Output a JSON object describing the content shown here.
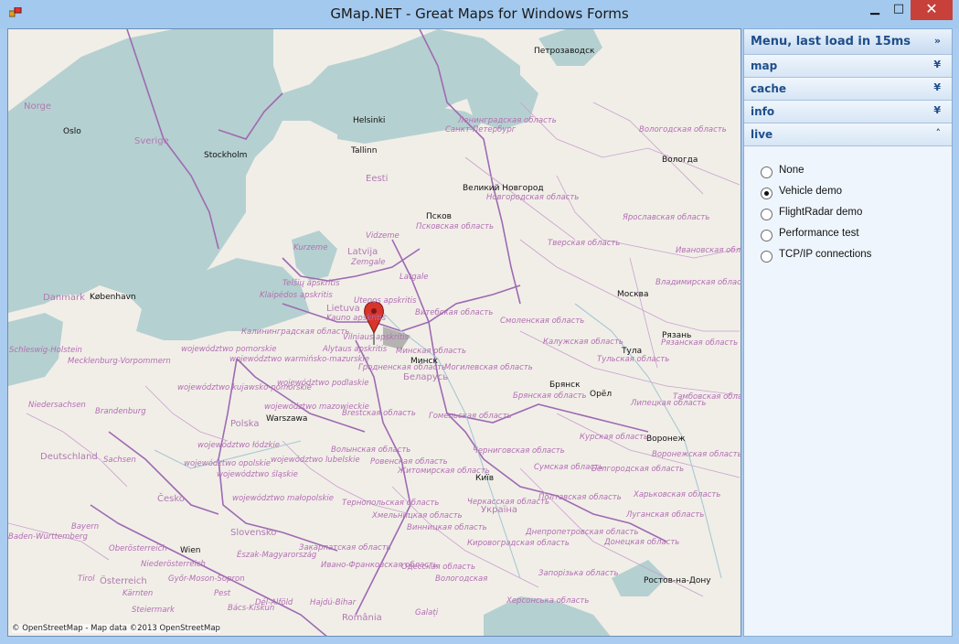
{
  "window": {
    "title": "GMap.NET - Great Maps for Windows Forms",
    "minimize": "▁",
    "maximize": "□",
    "close": "✕"
  },
  "map": {
    "copyright": "© OpenStreetMap - Map data ©2013 OpenStreetMap",
    "cities": [
      "Петрозаводск",
      "Helsinki",
      "Stockholm",
      "Oslo",
      "Tallinn",
      "Вологда",
      "Великий Новгород",
      "Псков",
      "København",
      "Москва",
      "Рязань",
      "Тула",
      "Минск",
      "Брянск",
      "Орёл",
      "Warszawa",
      "Воронеж",
      "Київ",
      "Wien",
      "Ростов-на-Дону"
    ],
    "countries": [
      "Norge",
      "Sverige",
      "Eesti",
      "Latvija",
      "Lietuva",
      "Danmark",
      "Беларусь",
      "Polska",
      "Deutschland",
      "Česko",
      "Slovensko",
      "Україна",
      "România",
      "Österreich"
    ],
    "regions": [
      "Ленинградская область",
      "Санкт-Петербург",
      "Вологодская область",
      "Новгородская область",
      "Псковская область",
      "Ярославская область",
      "Тверская область",
      "Ивановская область",
      "Kurzeme",
      "Vidzeme",
      "Zemgale",
      "Latgale",
      "Telšių apskritis",
      "Klaipėdos apskritis",
      "Kauno apskritis",
      "Utenos apskritis",
      "Витебская область",
      "Смоленская область",
      "Владимирская область",
      "Калининградская область",
      "Vilniaus apskritis",
      "Alytaus apskritis",
      "Минская область",
      "Калужская область",
      "Рязанская область",
      "Тульская область",
      "Гродненская область",
      "Могилевская область",
      "Брянская область",
      "Липецкая область",
      "Тамбовская область",
      "Brestская область",
      "Гомельская область",
      "Курская область",
      "Воронежская область",
      "Черниговская область",
      "Сумская область",
      "Белгородская область",
      "Волынская область",
      "Ровенская область",
      "Житомирская область",
      "Полтавская область",
      "Харьковская область",
      "Луганская область",
      "Тернопольская область",
      "Хмельницкая область",
      "Винницкая область",
      "Черкасская область",
      "Днепропетровская область",
      "Донецкая область",
      "Кировоградская область",
      "Запорізька область",
      "Закарпатская область",
      "Ивано-Франковская область",
      "Херсонська область",
      "Одесская область",
      "Mecklenburg-Vorpommern",
      "Schleswig-Holstein",
      "Niedersachsen",
      "Brandenburg",
      "Sachsen",
      "Bayern",
      "Baden-Württemberg",
      "województwo pomorskie",
      "województwo warmińsko-mazurskie",
      "województwo kujawsko-pomorskie",
      "województwo mazowieckie",
      "województwo podlaskie",
      "województwo łódzkie",
      "województwo lubelskie",
      "województwo opolskie",
      "województwo śląskie",
      "województwo małopolskie",
      "Oberösterreich",
      "Tirol",
      "Kärnten",
      "Steiermark",
      "Niederösterreich",
      "Győr-Moson-Sopron",
      "Észak-Magyarország",
      "Pest",
      "Bács-Kiskun",
      "Dél-Alföld",
      "Hajdú-Bihar",
      "Galați",
      "Вологодская",
      "Приднестровье"
    ]
  },
  "panel": {
    "header": "Menu, last load in 15ms",
    "header_icon": "double-chevron-right",
    "sections": [
      {
        "label": "map",
        "icon": "double-chevron-down"
      },
      {
        "label": "cache",
        "icon": "double-chevron-down"
      },
      {
        "label": "info",
        "icon": "double-chevron-down"
      },
      {
        "label": "live",
        "icon": "double-chevron-up"
      }
    ],
    "live_options": [
      {
        "label": "None",
        "selected": false
      },
      {
        "label": "Vehicle demo",
        "selected": true
      },
      {
        "label": "FlightRadar demo",
        "selected": false
      },
      {
        "label": "Performance test",
        "selected": false
      },
      {
        "label": "TCP/IP connections",
        "selected": false
      }
    ]
  },
  "colors": {
    "water": "#b5d0d0",
    "land": "#f1eee8",
    "border": "#9e6ab2",
    "marker": "#d9342b",
    "accent": "#1f4f8a"
  }
}
